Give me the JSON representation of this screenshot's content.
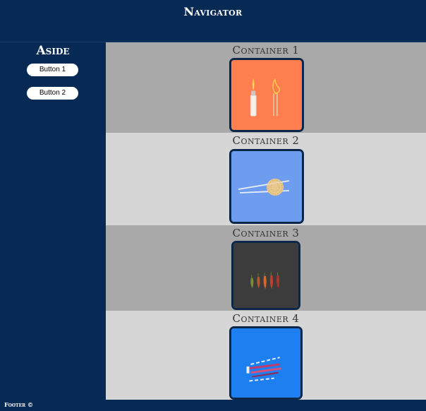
{
  "nav": {
    "title": "Navigator"
  },
  "aside": {
    "title": "Aside",
    "buttons": [
      {
        "label": "Button 1"
      },
      {
        "label": "Button 2"
      }
    ]
  },
  "containers": [
    {
      "title": "Container 1",
      "background": "#a9a9a9",
      "image_bg": "#ff7e4f",
      "image": "lighter-and-matches"
    },
    {
      "title": "Container 2",
      "background": "#d6d6d6",
      "image_bg": "#6e9cef",
      "image": "chopsticks-and-noodles"
    },
    {
      "title": "Container 3",
      "background": "#a9a9a9",
      "image_bg": "#3c3c3c",
      "image": "chili-peppers"
    },
    {
      "title": "Container 4",
      "background": "#d6d6d6",
      "image_bg": "#1d7ff0",
      "image": "sticks-and-pens"
    }
  ],
  "footer": {
    "text": "Footer ©"
  },
  "colors": {
    "dark": "#072a55",
    "border": "#0b2748"
  }
}
